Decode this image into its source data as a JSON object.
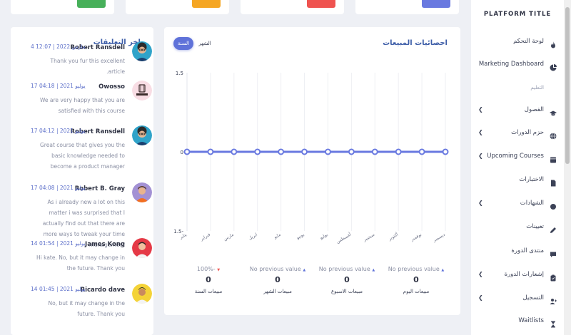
{
  "colors": {
    "accent": "#5f72d9",
    "card_green": "#47b05a",
    "card_orange": "#f5a623",
    "card_red": "#ef5350",
    "card_blue": "#6979e0",
    "link": "#3e5ea8"
  },
  "comments_panel": {
    "title": "اخر التعليقات",
    "items": [
      {
        "name": "Robert Ransdell",
        "date": "4 مارس 2022 | 12:07",
        "text": "Thank you fur this excellent article.",
        "avatar": "avatar-blue"
      },
      {
        "name": "Owosso",
        "date": "17 يوليو 2021 | 04:18",
        "text": "We are very happy that you are satisfied with this course",
        "avatar": "owosso-logo"
      },
      {
        "name": "Robert Ransdell",
        "date": "17 يوليو 2021 | 04:12",
        "text": "Great course that gives you the basic knowledge needed to become a product manager",
        "avatar": "avatar-blue"
      },
      {
        "name": "Robert B. Gray",
        "date": "17 يوليو 2021 | 04:08",
        "text": "As i already new a lot on this matter i was surprised that I actually find out that there are more ways to tweak your time management",
        "avatar": "avatar-purple"
      },
      {
        "name": "James Kong",
        "date": "14 يوليو 2021 | 01:54",
        "text": "Hi kate. No, but it may change in the future. Thank you",
        "avatar": "avatar-red"
      },
      {
        "name": "Ricardo dave",
        "date": "14 يوليو 2021 | 01:45",
        "text": "No, but it may change in the future. Thank you",
        "avatar": "avatar-yellow"
      }
    ]
  },
  "sales_panel": {
    "title": "احصائيات المبيعات",
    "toggle_year": "السنة",
    "toggle_month": "الشهر",
    "stats": [
      {
        "change": "No previous value",
        "direction": "up",
        "value": "0",
        "label": "مبيعات اليوم"
      },
      {
        "change": "No previous value",
        "direction": "up",
        "value": "0",
        "label": "مبيعات الاسبوع"
      },
      {
        "change": "No previous value",
        "direction": "up",
        "value": "0",
        "label": "مبيعات الشهر"
      },
      {
        "change": "100%-",
        "direction": "down",
        "value": "0",
        "label": "مبيعات السنة"
      }
    ]
  },
  "chart_data": {
    "type": "line",
    "categories": [
      "يناير",
      "فبراير",
      "مارس",
      "ابريل",
      "مايو",
      "يونيو",
      "يوليو",
      "أغسطس",
      "سبتمبر",
      "أكتوبر",
      "نوفمبر",
      "ديسمبر"
    ],
    "series": [
      {
        "values": [
          0,
          0,
          0,
          0,
          0,
          0,
          0,
          0,
          0,
          0,
          0,
          0
        ]
      }
    ],
    "ylim": [
      -1.5,
      1.5
    ],
    "yticks": [
      "1.5",
      "0",
      "1.5-"
    ],
    "xlabel": "",
    "ylabel": "",
    "grid": true,
    "line_color": "#6979e0"
  },
  "sidebar": {
    "brand": "PLATFORM TITLE",
    "section_label": "التعليم",
    "items": [
      {
        "label": "لوحة التحكم",
        "icon": "fire-icon",
        "expandable": false
      },
      {
        "label": "Marketing Dashboard",
        "icon": "pie-chart-icon",
        "expandable": false
      },
      {
        "label": "الفصول",
        "icon": "graduation-cap-icon",
        "expandable": true
      },
      {
        "label": "حزم الدورات",
        "icon": "globe-icon",
        "expandable": true
      },
      {
        "label": "Upcoming Courses",
        "icon": "calendar-icon",
        "expandable": true
      },
      {
        "label": "الاختبارات",
        "icon": "file-icon",
        "expandable": false
      },
      {
        "label": "الشهادات",
        "icon": "circle-icon",
        "expandable": true
      },
      {
        "label": "تعيينات",
        "icon": "pen-icon",
        "expandable": false
      },
      {
        "label": "منتدى الدورة",
        "icon": "comment-icon",
        "expandable": false
      },
      {
        "label": "إشعارات الدورة",
        "icon": "clipboard-icon",
        "expandable": true
      },
      {
        "label": "التسجيل",
        "icon": "user-plus-icon",
        "expandable": true
      },
      {
        "label": "Waitlists",
        "icon": "hourglass-icon",
        "expandable": false
      }
    ]
  }
}
